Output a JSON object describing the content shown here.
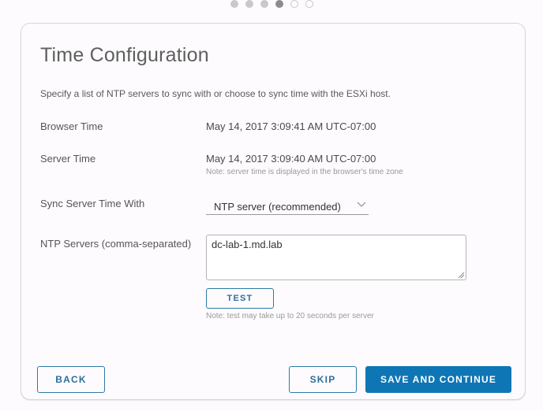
{
  "stepper": {
    "total_steps": 6,
    "current_step": 4,
    "steps": [
      "done",
      "done",
      "done",
      "current",
      "todo",
      "todo"
    ]
  },
  "page": {
    "title": "Time Configuration",
    "description": "Specify a list of NTP servers to sync with or choose to sync time with the ESXi host."
  },
  "fields": {
    "browser_time": {
      "label": "Browser Time",
      "value": "May 14, 2017 3:09:41 AM UTC-07:00"
    },
    "server_time": {
      "label": "Server Time",
      "value": "May 14, 2017 3:09:40 AM UTC-07:00",
      "note": "Note: server time is displayed in the browser's time zone"
    },
    "sync_with": {
      "label": "Sync Server Time With",
      "selected": "NTP server (recommended)",
      "icon": "chevron-down-icon"
    },
    "ntp_servers": {
      "label": "NTP Servers (comma-separated)",
      "value": "dc-lab-1.md.lab",
      "test_button": "TEST",
      "note": "Note: test may take up to 20 seconds per server"
    }
  },
  "footer": {
    "back_label": "BACK",
    "skip_label": "SKIP",
    "save_label": "SAVE AND CONTINUE"
  },
  "colors": {
    "primary": "#0f76b5",
    "outline": "#2c7ca6",
    "step_done": "#c9c9c9",
    "step_current": "#8c8c8c"
  }
}
